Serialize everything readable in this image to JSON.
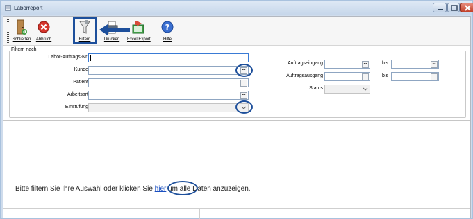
{
  "window": {
    "title": "Laborreport"
  },
  "toolbar": {
    "buttons": [
      {
        "label": "Schließen",
        "icon": "door-exit-icon"
      },
      {
        "label": "Abbruch",
        "icon": "cancel-icon"
      },
      {
        "label": "Filtern",
        "icon": "funnel-icon"
      },
      {
        "label": "Drucken",
        "icon": "printer-icon"
      },
      {
        "label": "Excel Export",
        "icon": "excel-export-icon"
      },
      {
        "label": "Hilfe",
        "icon": "help-icon"
      }
    ]
  },
  "filter": {
    "group_title": "Filtern nach",
    "fields": {
      "auftragsnr_label": "Labor-Auftrags-Nr.",
      "auftragsnr_value": "",
      "kunde_label": "Kunde",
      "kunde_value": "",
      "patient_label": "Patient",
      "patient_value": "",
      "arbeitsart_label": "Arbeitsart",
      "arbeitsart_value": "",
      "einstufung_label": "Einstufung",
      "einstufung_value": "",
      "auftragseingang_label": "Auftragseingang",
      "auftragseingang_value": "",
      "auftragseingang_bis_label": "bis",
      "auftragseingang_bis_value": "",
      "auftragsausgang_label": "Auftragsausgang",
      "auftragsausgang_value": "",
      "auftragsausgang_bis_label": "bis",
      "auftragsausgang_bis_value": "",
      "status_label": "Status",
      "status_value": ""
    },
    "ellipsis": "..."
  },
  "message": {
    "before": "Bitte filtern Sie Ihre Auswahl oder klicken Sie ",
    "link": "hier",
    "after": " um alle Daten anzuzeigen."
  },
  "colors": {
    "annotation": "#1d4f9b",
    "link": "#1a4fc0"
  }
}
